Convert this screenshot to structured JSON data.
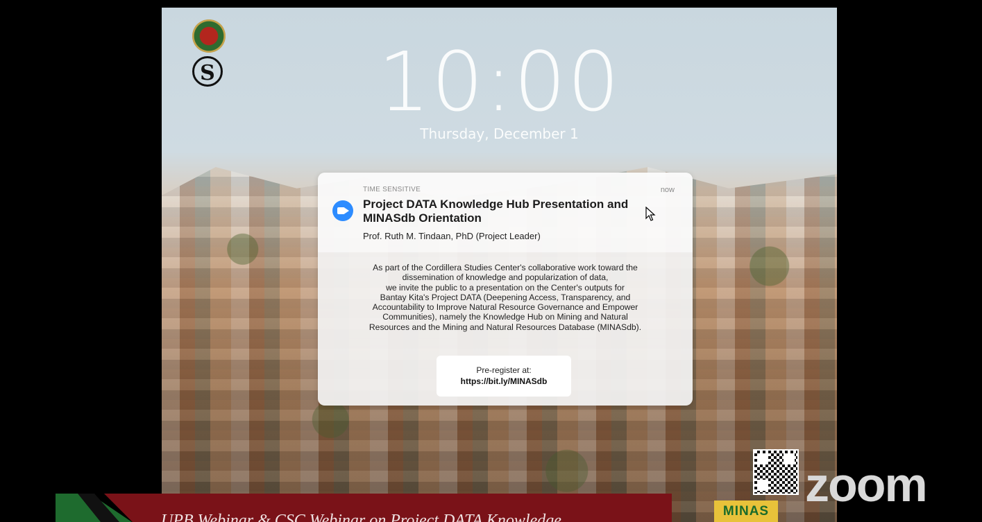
{
  "lockscreen": {
    "time": "10:00",
    "date": "Thursday, December 1"
  },
  "notification": {
    "label": "TIME SENSITIVE",
    "time_ago": "now",
    "title": "Project DATA Knowledge Hub Presentation and MINASdb Orientation",
    "subtitle": "Prof. Ruth M. Tindaan, PhD (Project Leader)",
    "body_lines": [
      "As part of the Cordillera Studies Center's collaborative work toward the",
      "dissemination of knowledge and popularization of data,",
      "we invite the public to a presentation on the Center's outputs for",
      "Bantay Kita's Project DATA (Deepening Access, Transparency, and",
      "Accountability to Improve Natural Resource Governance and Empower",
      "Communities), namely the Knowledge Hub on Mining and Natural",
      "Resources and the Mining and Natural Resources Database (MINASdb)."
    ],
    "prereg_label": "Pre-register at:",
    "prereg_link": "https://bit.ly/MINASdb"
  },
  "logos": {
    "seal_icon": "university-seal-icon",
    "s_logo_text": "S"
  },
  "branding": {
    "zoom_watermark": "zoom",
    "minas_logo": "MINAS"
  },
  "banner": {
    "text": "UPB Webinar & CSC Webinar on Project DATA Knowledge"
  },
  "colors": {
    "zoom_blue": "#2d8cff",
    "banner_red": "#7a1218",
    "banner_green": "#1e6b2e",
    "minas_yellow": "#e8c23a"
  }
}
